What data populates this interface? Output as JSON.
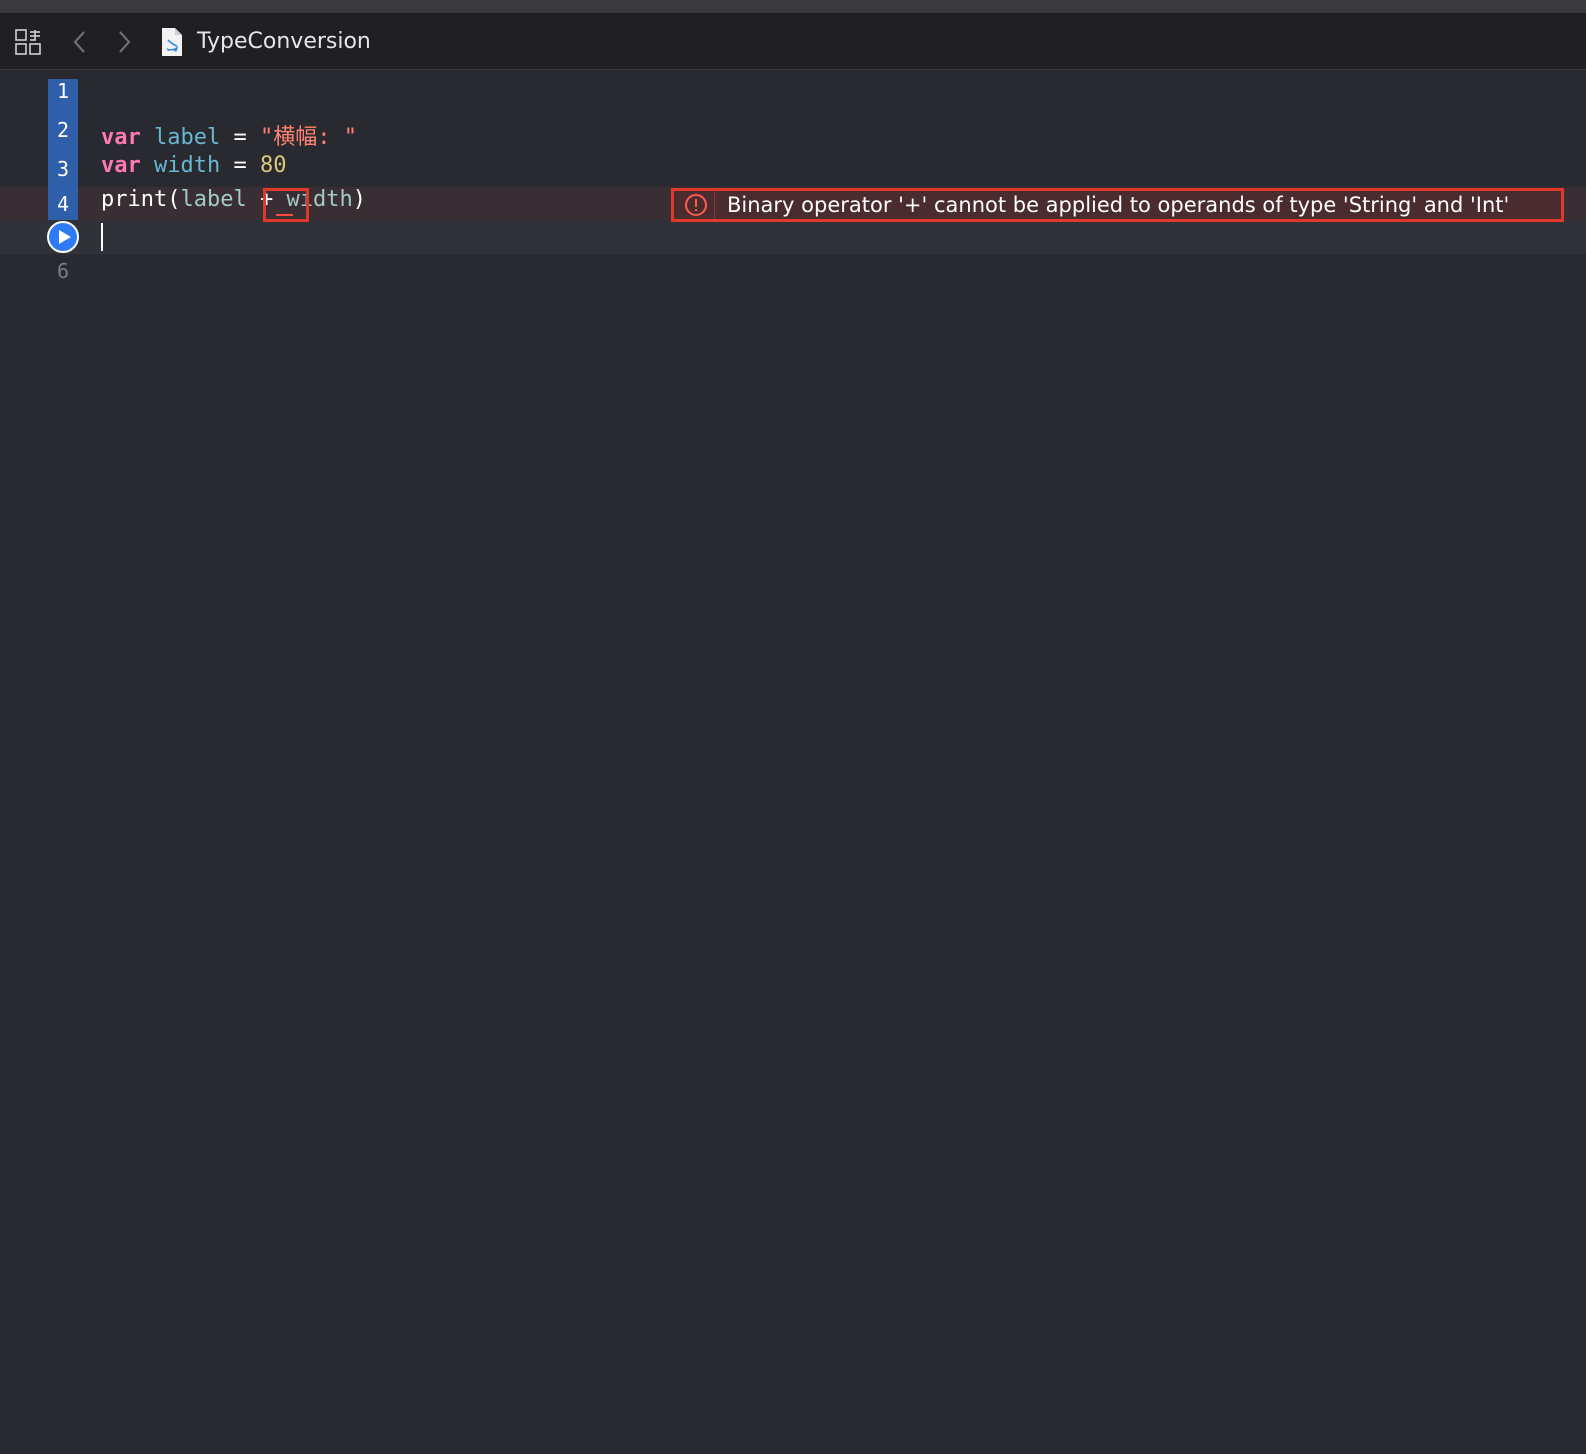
{
  "jumpbar": {
    "file_name": "TypeConversion",
    "icons": [
      "grid-icon",
      "chevron-left-icon",
      "chevron-right-icon",
      "swift-file-icon"
    ]
  },
  "editor": {
    "line_numbers": [
      "1",
      "2",
      "3",
      "4",
      "6"
    ],
    "lines": {
      "l2": {
        "kw": "var",
        "ident": "label",
        "eq": "=",
        "str": "\"横幅: \""
      },
      "l3": {
        "kw": "var",
        "ident": "width",
        "eq": "=",
        "num": "80"
      },
      "l4": {
        "fn": "print(",
        "arg1": "label",
        "op": "+",
        "arg2": "width",
        "close": ")"
      }
    },
    "error_message": "Binary operator '+' cannot be applied to operands of type 'String' and 'Int'",
    "colors": {
      "keyword": "#ff7ab2",
      "identifier": "#67b7d1",
      "string": "#ff8170",
      "number": "#d9c97c",
      "error": "#e0382b",
      "gutter_accent": "#2e5fa8"
    }
  }
}
